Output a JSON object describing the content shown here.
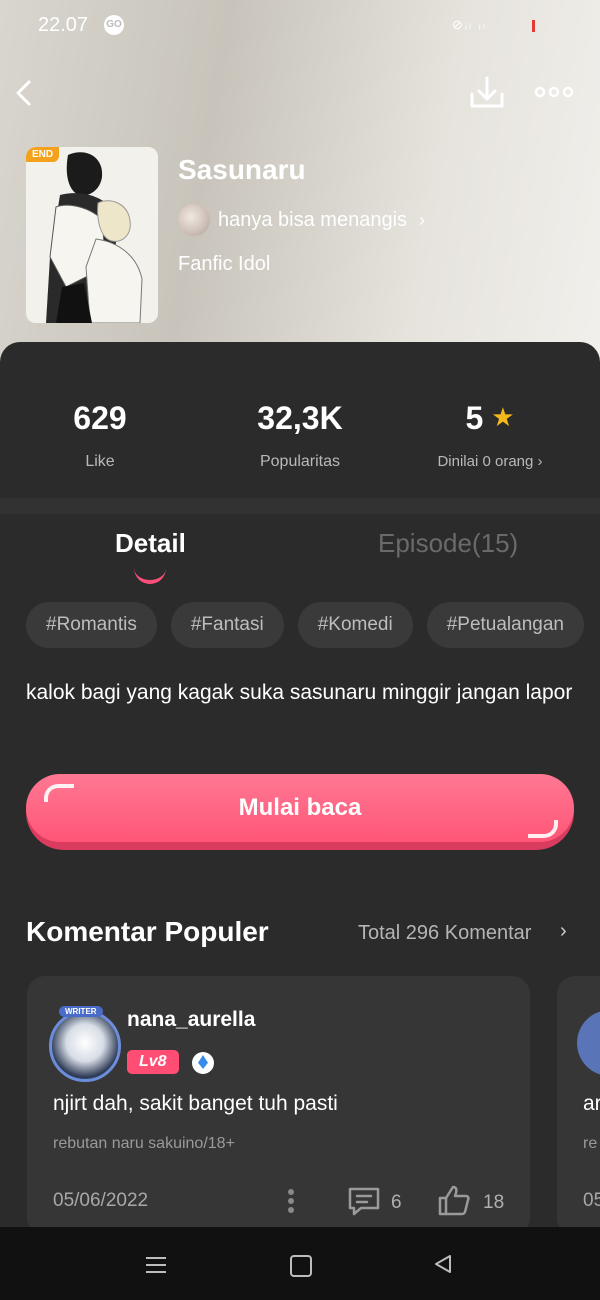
{
  "status_bar": {
    "time": "22.07",
    "bubble_text": "GO",
    "icons_text": "⊘ᵢₗ ᵢₗ"
  },
  "header": {
    "back_icon": "chevron-left-icon",
    "download_icon": "download-icon",
    "more_icon": "more-horizontal-icon"
  },
  "book": {
    "badge": "END",
    "title": "Sasunaru",
    "author": "hanya bisa menangis",
    "category": "Fanfic Idol"
  },
  "stats": {
    "likes": {
      "value": "629",
      "label": "Like"
    },
    "popularity": {
      "value": "32,3K",
      "label": "Popularitas"
    },
    "rating": {
      "value": "5",
      "label": "Dinilai 0 orang"
    }
  },
  "tabs": {
    "detail": "Detail",
    "episode": "Episode(15)"
  },
  "tags": [
    "#Romantis",
    "#Fantasi",
    "#Komedi",
    "#Petualangan"
  ],
  "synopsis": "kalok bagi yang kagak suka sasunaru minggir jangan lapor",
  "cta": {
    "label": "Mulai baca"
  },
  "comments_section": {
    "title": "Komentar Populer",
    "total": "Total 296 Komentar"
  },
  "comments": [
    {
      "badge": "WRITER",
      "user": "nana_aurella",
      "level": "Lv8",
      "text": "njirt dah, sakit banget tuh pasti",
      "ref": "rebutan naru sakuino/18+",
      "date": "05/06/2022",
      "replies": "6",
      "likes": "18"
    }
  ],
  "peek_card": {
    "text": "ar",
    "ref": "re",
    "date": "05"
  },
  "colors": {
    "accent": "#ff5677",
    "star": "#f6b81a",
    "panel": "#2b2b2b"
  }
}
